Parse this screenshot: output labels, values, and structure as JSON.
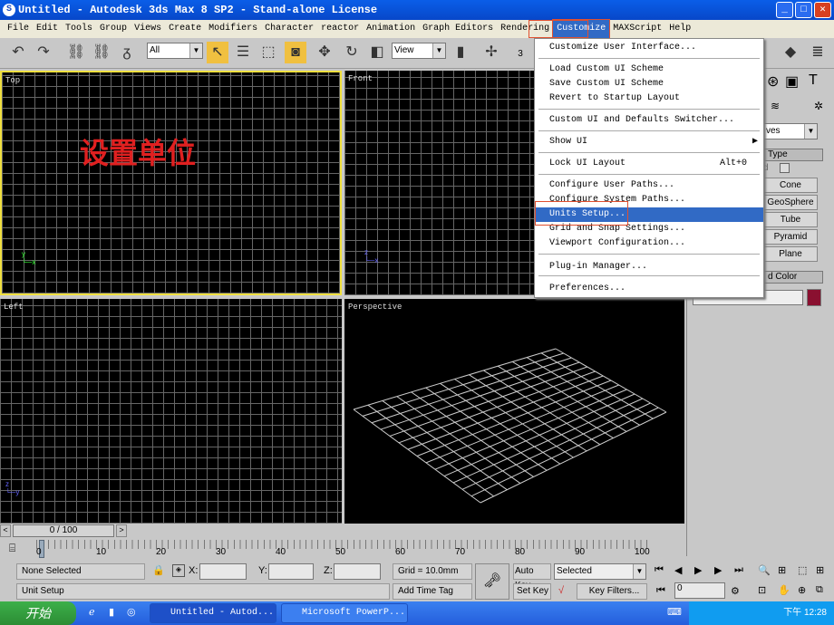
{
  "title": "Untitled - Autodesk 3ds Max 8 SP2  - Stand-alone License",
  "menubar": [
    "File",
    "Edit",
    "Tools",
    "Group",
    "Views",
    "Create",
    "Modifiers",
    "Character",
    "reactor",
    "Animation",
    "Graph Editors",
    "Rendering",
    "Customize",
    "MAXScript",
    "Help"
  ],
  "toolbar": {
    "selection_filter": "All",
    "ref_coord": "View",
    "snap_label": "3"
  },
  "viewports": {
    "top": "Top",
    "front": "Front",
    "left": "Left",
    "perspective": "Perspective"
  },
  "annotation": "设置单位",
  "customize_menu": {
    "items": [
      {
        "label": "Customize User Interface..."
      },
      {
        "label": "Load Custom UI Scheme"
      },
      {
        "label": "Save Custom UI Scheme"
      },
      {
        "label": "Revert to Startup Layout"
      },
      {
        "label": "Custom UI and Defaults Switcher..."
      },
      {
        "label": "Show UI",
        "submenu": "▶"
      },
      {
        "label": "Lock UI Layout",
        "shortcut": "Alt+0"
      },
      {
        "label": "Configure User Paths..."
      },
      {
        "label": "Configure System Paths..."
      },
      {
        "label": "Units Setup...",
        "highlighted": true
      },
      {
        "label": "Grid and Snap Settings..."
      },
      {
        "label": "Viewport Configuration..."
      },
      {
        "label": "Plug-in Manager..."
      },
      {
        "label": "Preferences..."
      }
    ]
  },
  "command_panel": {
    "dropdown": "ves",
    "rollout_type": "Type",
    "autogrid": "d",
    "buttons": [
      "Cone",
      "GeoSphere",
      "Tube",
      "Pyramid",
      "Plane"
    ],
    "rollout_color": "d Color",
    "swatch_color": "#8a1030"
  },
  "timeline": {
    "slider": "0 / 100",
    "ticks": [
      "0",
      "10",
      "20",
      "30",
      "40",
      "50",
      "60",
      "70",
      "80",
      "90",
      "100"
    ]
  },
  "status": {
    "selection": "None Selected",
    "prompt": "Unit Setup",
    "x_label": "X:",
    "y_label": "Y:",
    "z_label": "Z:",
    "grid": "Grid = 10.0mm",
    "add_time_tag": "Add Time Tag",
    "auto_key": "Auto Key",
    "set_key": "Set Key",
    "key_mode": "Selected",
    "key_filters": "Key Filters...",
    "frame": "0"
  },
  "taskbar": {
    "start": "开始",
    "tasks": [
      "Untitled - Autod...",
      "Microsoft PowerP..."
    ],
    "clock": "下午 12:28"
  },
  "colors": {
    "title_bar": "#0747c9",
    "highlight": "#316ac5",
    "active_viewport_border": "#f0e040",
    "annotation": "#e02020"
  }
}
